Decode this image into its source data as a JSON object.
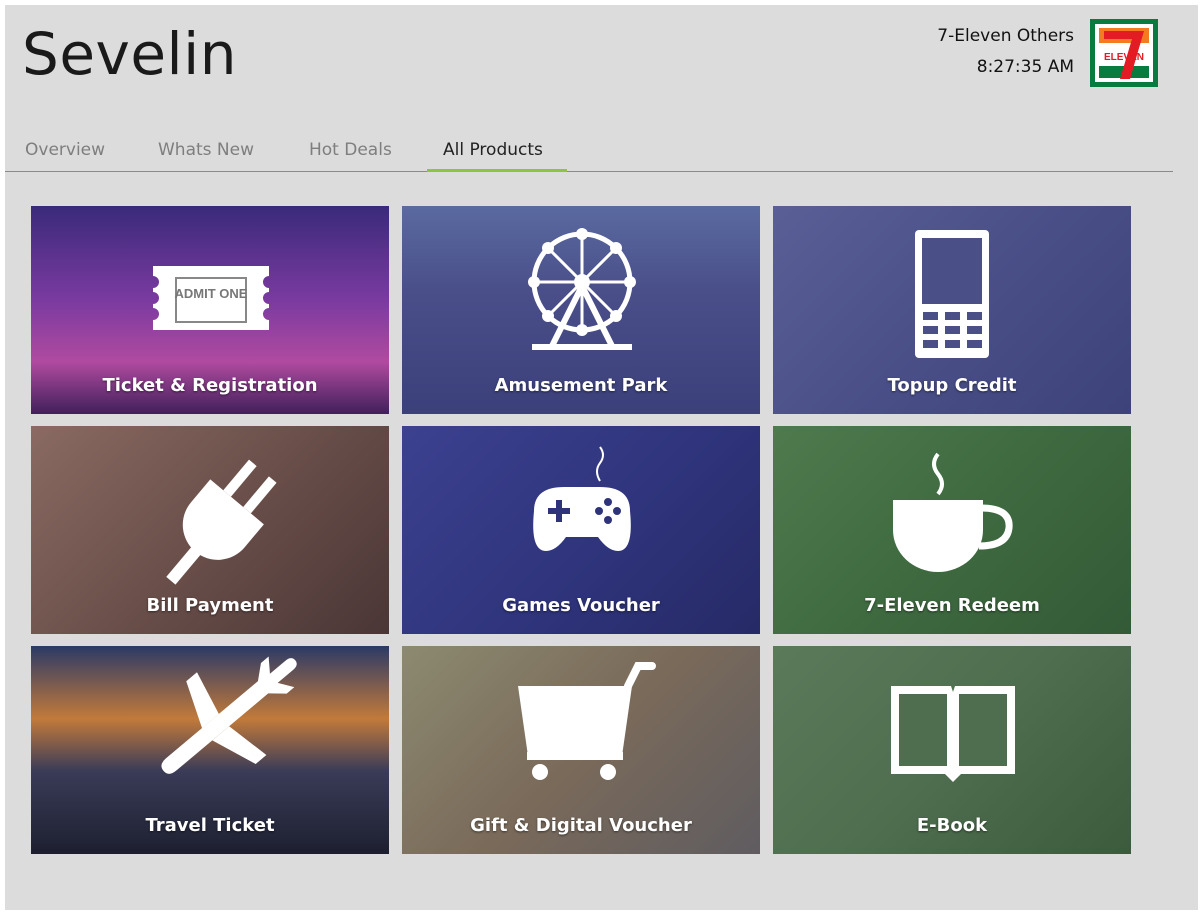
{
  "app": {
    "title": "Sevelin"
  },
  "user": {
    "name": "7-Eleven Others",
    "time": "8:27:35 AM"
  },
  "logo": {
    "text": "ELEVEN",
    "number": "7"
  },
  "tabs": [
    {
      "label": "Overview",
      "active": false
    },
    {
      "label": "Whats New",
      "active": false
    },
    {
      "label": "Hot Deals",
      "active": false
    },
    {
      "label": "All Products",
      "active": true
    }
  ],
  "tiles": [
    {
      "label": "Ticket & Registration",
      "icon": "ticket-icon",
      "ticket_text": "ADMIT ONE"
    },
    {
      "label": "Amusement Park",
      "icon": "ferris-wheel-icon"
    },
    {
      "label": "Topup Credit",
      "icon": "mobile-phone-icon"
    },
    {
      "label": "Bill Payment",
      "icon": "plug-icon"
    },
    {
      "label": "Games Voucher",
      "icon": "gamepad-icon"
    },
    {
      "label": "7-Eleven Redeem",
      "icon": "coffee-cup-icon"
    },
    {
      "label": "Travel Ticket",
      "icon": "airplane-icon"
    },
    {
      "label": "Gift & Digital Voucher",
      "icon": "shopping-cart-icon"
    },
    {
      "label": "E-Book",
      "icon": "open-book-icon"
    }
  ],
  "colors": {
    "accent": "#8cc63f",
    "background": "#dcdcdc"
  }
}
